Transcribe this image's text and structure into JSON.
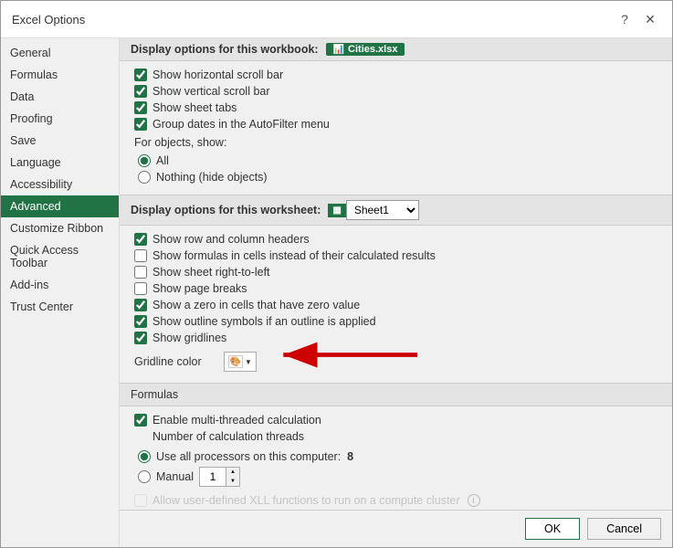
{
  "dialog": {
    "title": "Excel Options",
    "help_btn": "?",
    "close_btn": "✕"
  },
  "sidebar": {
    "items": [
      {
        "label": "General",
        "active": false
      },
      {
        "label": "Formulas",
        "active": false
      },
      {
        "label": "Data",
        "active": false
      },
      {
        "label": "Proofing",
        "active": false
      },
      {
        "label": "Save",
        "active": false
      },
      {
        "label": "Language",
        "active": false
      },
      {
        "label": "Accessibility",
        "active": false
      },
      {
        "label": "Advanced",
        "active": true
      },
      {
        "label": "Customize Ribbon",
        "active": false
      },
      {
        "label": "Quick Access Toolbar",
        "active": false
      },
      {
        "label": "Add-ins",
        "active": false
      },
      {
        "label": "Trust Center",
        "active": false
      }
    ]
  },
  "workbook_section": {
    "header": "Display options for this workbook:",
    "workbook_name": "Cities.xlsx",
    "checkboxes": [
      {
        "label": "Show horizontal scroll bar",
        "checked": true
      },
      {
        "label": "Show vertical scroll bar",
        "checked": true
      },
      {
        "label": "Show sheet tabs",
        "checked": true
      },
      {
        "label": "Group dates in the AutoFilter menu",
        "checked": true
      }
    ],
    "for_objects_label": "For objects, show:",
    "radios": [
      {
        "label": "All",
        "checked": true
      },
      {
        "label": "Nothing (hide objects)",
        "checked": false
      }
    ]
  },
  "worksheet_section": {
    "header": "Display options for this worksheet:",
    "sheet_name": "Sheet1",
    "checkboxes": [
      {
        "label": "Show row and column headers",
        "checked": true
      },
      {
        "label": "Show formulas in cells instead of their calculated results",
        "checked": false
      },
      {
        "label": "Show sheet right-to-left",
        "checked": false
      },
      {
        "label": "Show page breaks",
        "checked": false
      },
      {
        "label": "Show a zero in cells that have zero value",
        "checked": true
      },
      {
        "label": "Show outline symbols if an outline is applied",
        "checked": true
      },
      {
        "label": "Show gridlines",
        "checked": true
      }
    ],
    "gridline_color_label": "Gridline color",
    "color_swatch_char": "🎨"
  },
  "formulas_section": {
    "header": "Formulas",
    "checkboxes": [
      {
        "label": "Enable multi-threaded calculation",
        "checked": true
      }
    ],
    "threads_label": "Number of calculation threads",
    "radios": [
      {
        "label": "Use all processors on this computer:",
        "checked": true,
        "value": "8"
      },
      {
        "label": "Manual",
        "checked": false,
        "spin_value": "1"
      }
    ],
    "allow_xll_label": "Allow user-defined XLL functions to run on a compute cluster",
    "allow_xll_checked": false
  },
  "footer": {
    "ok_label": "OK",
    "cancel_label": "Cancel"
  }
}
